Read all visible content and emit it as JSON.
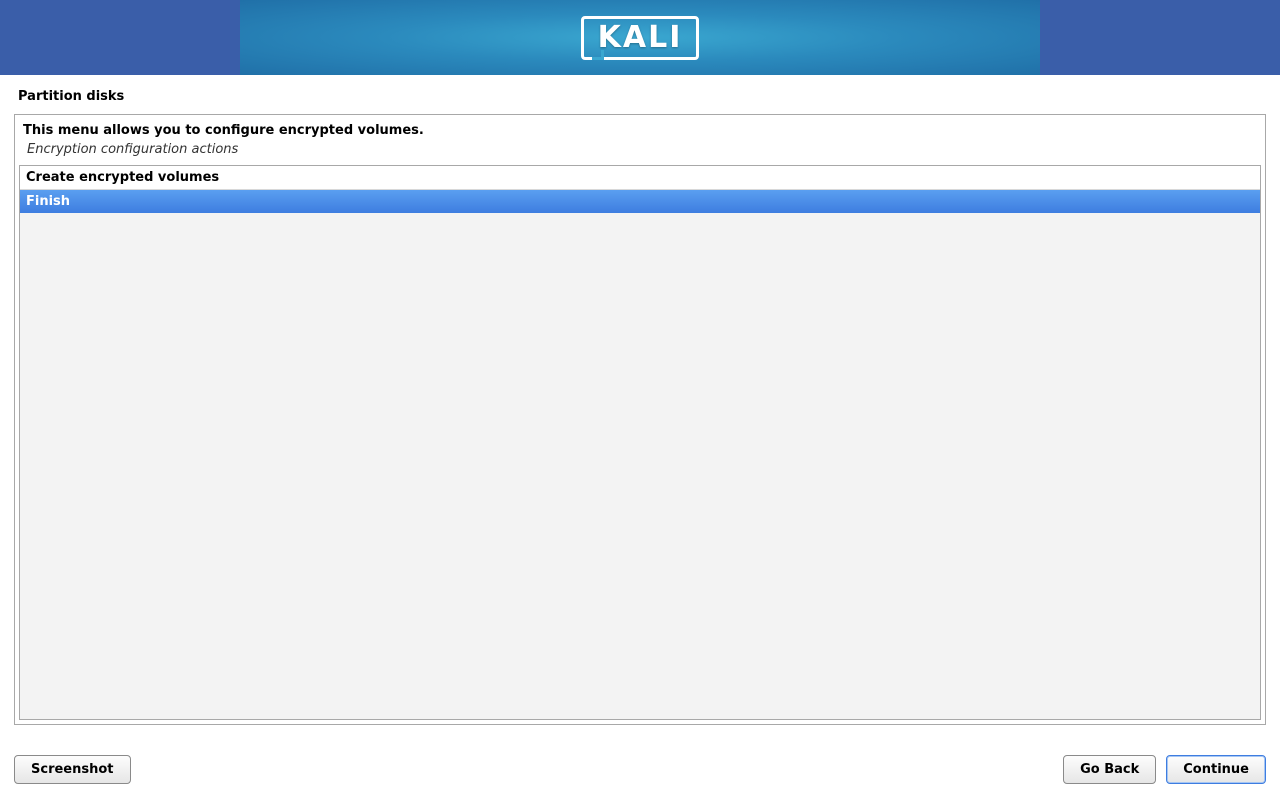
{
  "brand_text": "KALI",
  "page_title": "Partition disks",
  "intro_text": "This menu allows you to configure encrypted volumes.",
  "subheading": "Encryption configuration actions",
  "list": {
    "items": [
      {
        "label": "Create encrypted volumes",
        "selected": false
      },
      {
        "label": "Finish",
        "selected": true
      }
    ]
  },
  "buttons": {
    "screenshot": "Screenshot",
    "go_back": "Go Back",
    "continue": "Continue"
  }
}
